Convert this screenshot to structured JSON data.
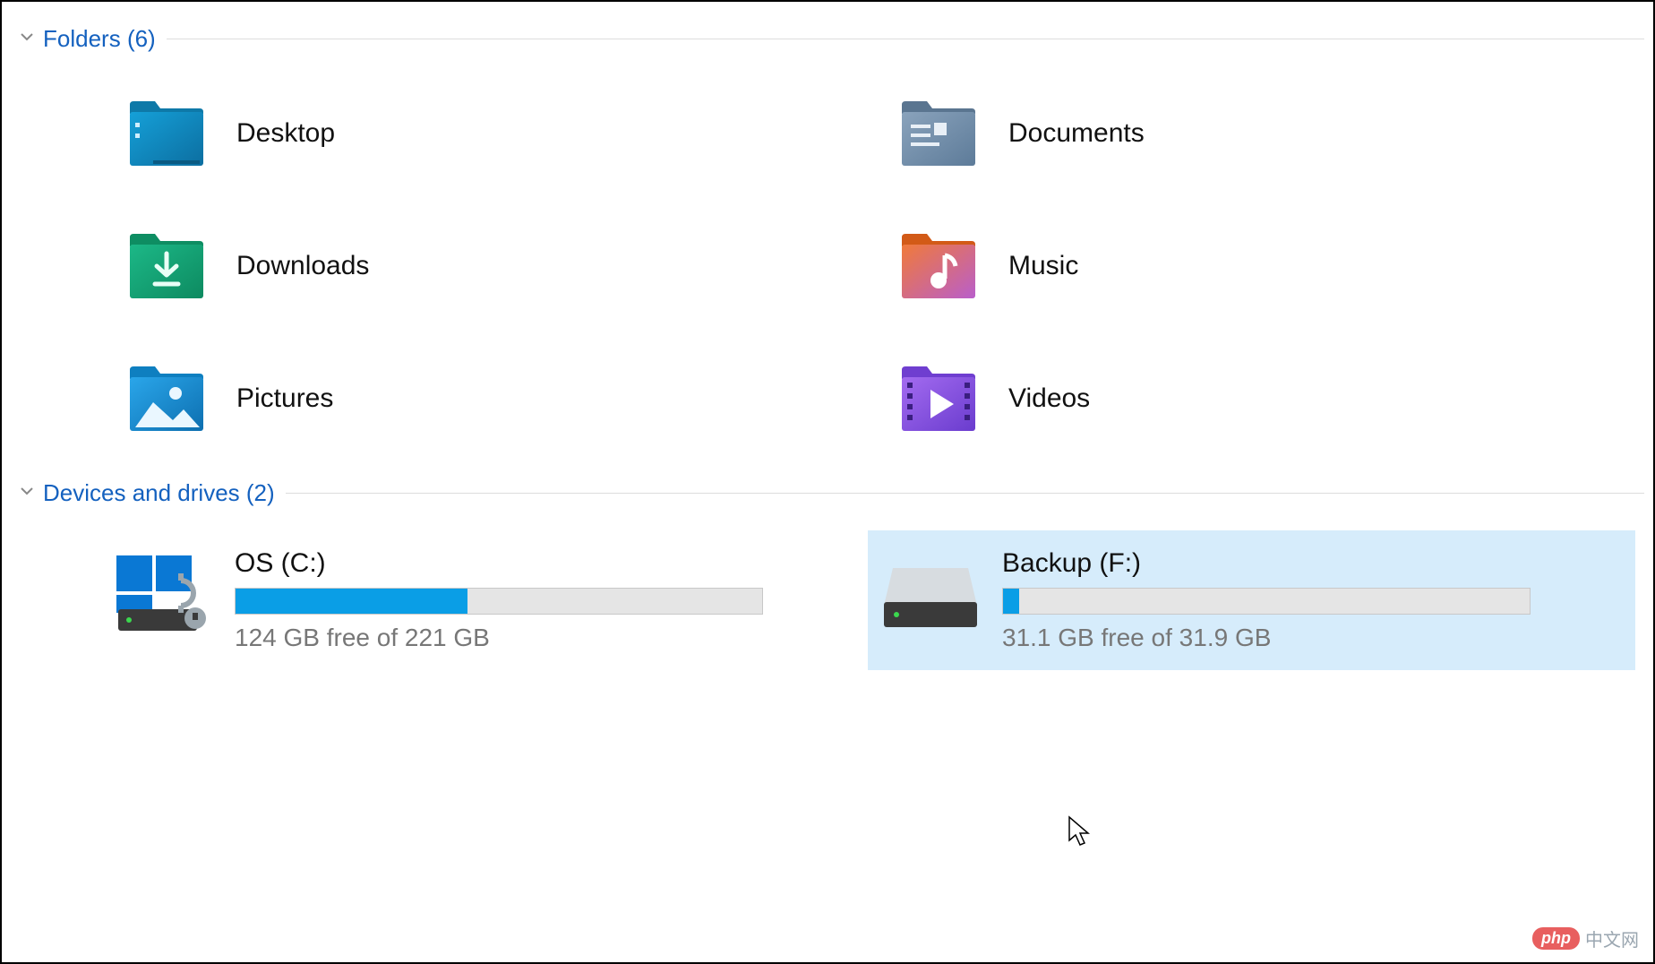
{
  "sections": {
    "folders": {
      "label": "Folders",
      "count_label": "(6)"
    },
    "drives": {
      "label": "Devices and drives",
      "count_label": "(2)"
    }
  },
  "folders": [
    {
      "name": "Desktop",
      "icon": "desktop"
    },
    {
      "name": "Documents",
      "icon": "documents"
    },
    {
      "name": "Downloads",
      "icon": "downloads"
    },
    {
      "name": "Music",
      "icon": "music"
    },
    {
      "name": "Pictures",
      "icon": "pictures"
    },
    {
      "name": "Videos",
      "icon": "videos"
    }
  ],
  "drives": [
    {
      "label": "OS (C:)",
      "free_text": "124 GB free of 221 GB",
      "used_pct": 44,
      "selected": false,
      "icon": "os-drive"
    },
    {
      "label": "Backup (F:)",
      "free_text": "31.1 GB free of 31.9 GB",
      "used_pct": 3,
      "selected": true,
      "icon": "hdd"
    }
  ],
  "colors": {
    "accent_link": "#1461bf",
    "drive_fill": "#0a9ee6",
    "selection_bg": "#d6ecfb"
  },
  "watermark": {
    "badge": "php",
    "text": "中文网"
  }
}
